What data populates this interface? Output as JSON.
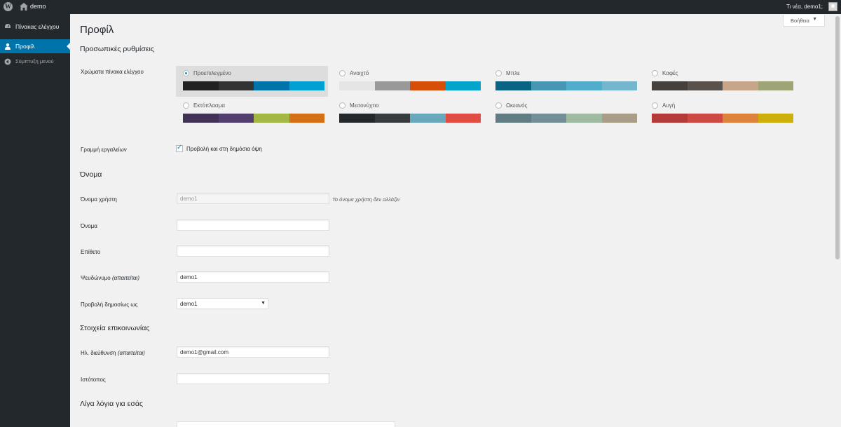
{
  "adminbar": {
    "site_name": "demo",
    "greeting": "Τι νέα, demo1;"
  },
  "sidebar": {
    "items": [
      {
        "label": "Πίνακας ελέγχου",
        "icon": "dashboard-icon"
      },
      {
        "label": "Προφίλ",
        "icon": "user-icon"
      },
      {
        "label": "Σύμπτυξη μενού",
        "icon": "collapse-icon"
      }
    ]
  },
  "help_tab": {
    "label": "Βοήθεια",
    "arrow": "▼"
  },
  "page": {
    "title": "Προφίλ"
  },
  "personal": {
    "heading": "Προσωπικές ρυθμίσεις",
    "color_label": "Χρώματα πίνακα ελέγχου",
    "schemes": [
      {
        "name": "Προεπιλεγμένο",
        "selected": true,
        "colors": [
          "#222222",
          "#333333",
          "#0073aa",
          "#00a0d2"
        ]
      },
      {
        "name": "Ανοιχτό",
        "selected": false,
        "colors": [
          "#e5e5e5",
          "#999999",
          "#d64e07",
          "#04a4cc"
        ]
      },
      {
        "name": "Μπλε",
        "selected": false,
        "colors": [
          "#096484",
          "#4796b3",
          "#52accc",
          "#74b6ce"
        ]
      },
      {
        "name": "Καφές",
        "selected": false,
        "colors": [
          "#46403c",
          "#59524c",
          "#c7a589",
          "#9ea476"
        ]
      },
      {
        "name": "Εκτόπλασμα",
        "selected": false,
        "colors": [
          "#413256",
          "#523f6d",
          "#a3b745",
          "#d46f15"
        ]
      },
      {
        "name": "Μεσονύχτιο",
        "selected": false,
        "colors": [
          "#25282b",
          "#363b3f",
          "#69a8bb",
          "#e14d43"
        ]
      },
      {
        "name": "Ωκεανός",
        "selected": false,
        "colors": [
          "#627c83",
          "#738e96",
          "#9ebaa0",
          "#aa9d88"
        ]
      },
      {
        "name": "Αυγή",
        "selected": false,
        "colors": [
          "#b43c38",
          "#cf4944",
          "#dd823b",
          "#ccaf0b"
        ]
      }
    ],
    "toolbar_label": "Γραμμή εργαλείων",
    "toolbar_checkbox_label": "Προβολή και στη δημόσια όψη"
  },
  "name_section": {
    "heading": "Όνομα",
    "username_label": "Όνομα χρήστη",
    "username_value": "demo1",
    "username_desc": "Το όνομα χρήστη δεν αλλάζει",
    "first_name_label": "Όνομα",
    "first_name_value": "",
    "last_name_label": "Επίθετο",
    "last_name_value": "",
    "nickname_label": "Ψευδώνυμο",
    "required": "(απαιτείται)",
    "nickname_value": "demo1",
    "display_label": "Προβολή δημοσίως ως",
    "display_value": "demo1"
  },
  "contact": {
    "heading": "Στοιχεία επικοινωνίας",
    "email_label": "Ηλ. διεύθυνση",
    "required": "(απαιτείται)",
    "email_value": "demo1@gmail.com",
    "website_label": "Ιστότοπος",
    "website_value": ""
  },
  "about": {
    "heading": "Λίγα λόγια για εσάς"
  }
}
